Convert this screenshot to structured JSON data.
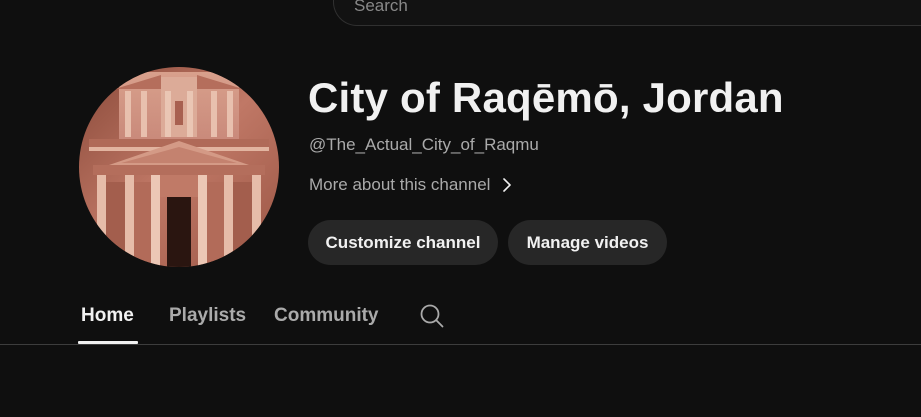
{
  "header": {
    "search": {
      "placeholder": "Search"
    }
  },
  "channel": {
    "title": "City of Raqēmō, Jordan",
    "handle": "@The_Actual_City_of_Raqmu",
    "more_about_label": "More about this channel",
    "avatar_icon": "channel-avatar-petra-treasury"
  },
  "actions": {
    "customize_label": "Customize channel",
    "manage_label": "Manage videos"
  },
  "tabs": [
    {
      "label": "Home",
      "active": true
    },
    {
      "label": "Playlists",
      "active": false
    },
    {
      "label": "Community",
      "active": false
    }
  ],
  "tab_search_icon": "search-icon",
  "colors": {
    "background": "#0f0f0f",
    "button_bg": "#272727",
    "text_primary": "#f1f1f1",
    "text_secondary": "#aaaaaa",
    "divider": "#3d3d3d"
  }
}
